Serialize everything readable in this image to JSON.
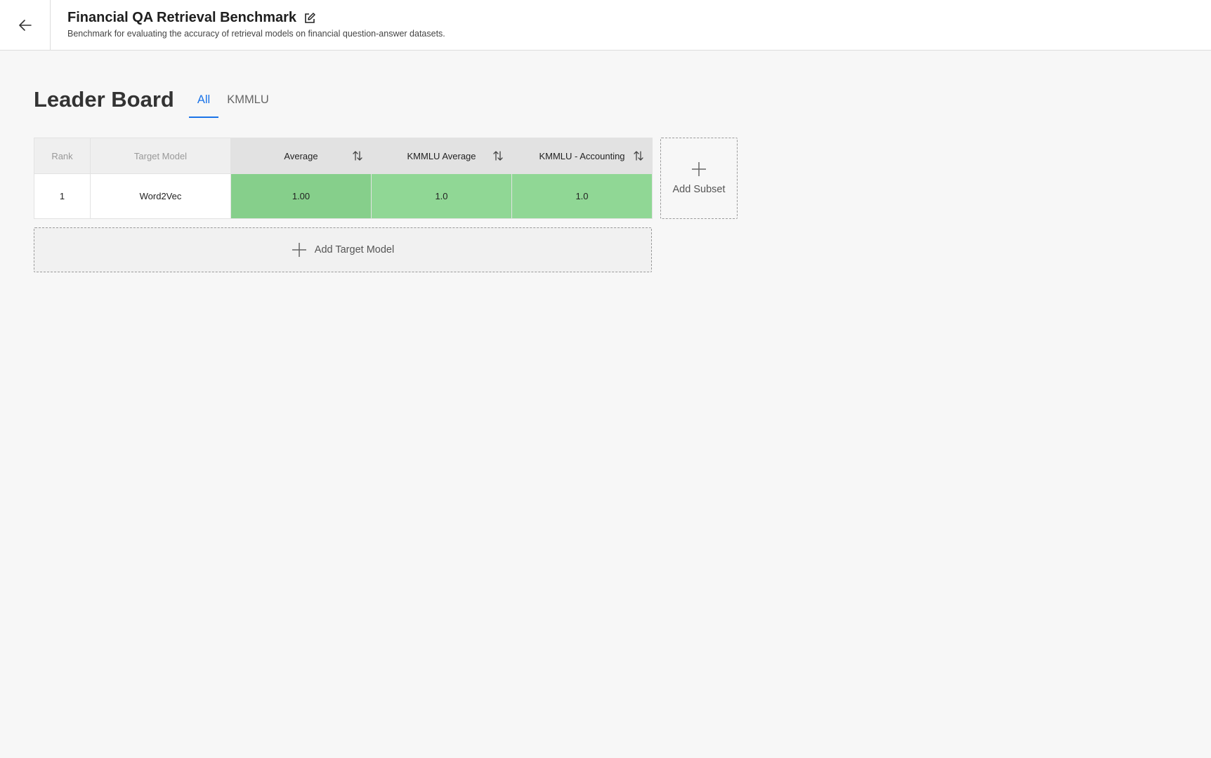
{
  "header": {
    "title": "Financial QA Retrieval Benchmark",
    "subtitle": "Benchmark for evaluating the accuracy of retrieval models on financial question-answer datasets.",
    "back_icon": "arrow-left-icon",
    "edit_icon": "edit-icon"
  },
  "leaderboard": {
    "title": "Leader Board",
    "tabs": [
      {
        "label": "All",
        "active": true
      },
      {
        "label": "KMMLU",
        "active": false
      }
    ],
    "columns": [
      "Rank",
      "Target Model",
      "Average",
      "KMMLU Average",
      "KMMLU - Accounting"
    ],
    "rows": [
      {
        "rank": "1",
        "model": "Word2Vec",
        "average": "1.00",
        "kmmlu_average": "1.0",
        "kmmlu_accounting": "1.0"
      }
    ],
    "add_subset_label": "Add Subset",
    "add_model_label": "Add Target Model"
  },
  "colors": {
    "accent": "#1a73e8",
    "score_high": "#90d795"
  }
}
